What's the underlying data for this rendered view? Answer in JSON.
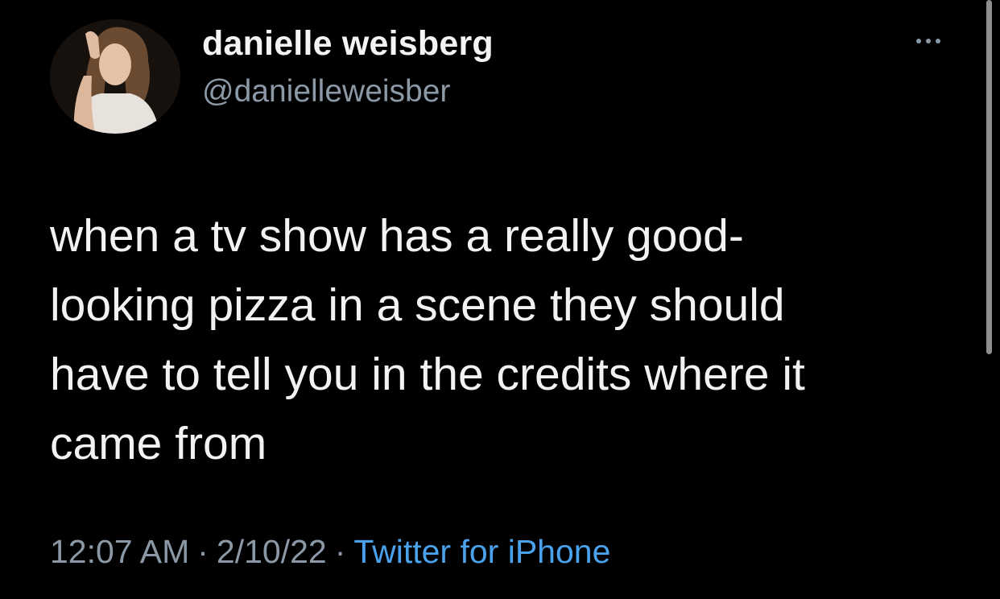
{
  "tweet": {
    "display_name": "danielle weisberg",
    "handle": "@danielleweisber",
    "text": "when a tv show has a really good-\nlooking pizza in a scene they should\nhave to tell you in the credits where it\ncame from",
    "time": "12:07 AM",
    "date": "2/10/22",
    "separator": "·",
    "source": "Twitter for iPhone",
    "more_icon": "more-horizontal-icon"
  },
  "colors": {
    "background": "#000000",
    "text": "#f2f2f2",
    "secondary": "#8b98a5",
    "link": "#4aa1ec"
  }
}
